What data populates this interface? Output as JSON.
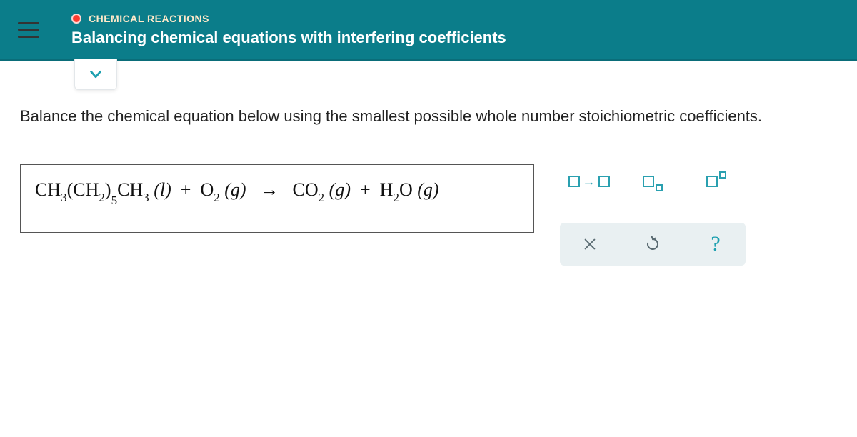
{
  "header": {
    "category": "CHEMICAL REACTIONS",
    "title": "Balancing chemical equations with interfering coefficients"
  },
  "instruction": "Balance the chemical equation below using the smallest possible whole number stoichiometric coefficients.",
  "equation": {
    "reactant1": {
      "ch3a": "CH",
      "ch3a_sub": "3",
      "open": "(",
      "ch2": "CH",
      "ch2_sub": "2",
      "close": ")",
      "outer_sub": "5",
      "ch3b": "CH",
      "ch3b_sub": "3",
      "state": "(l)"
    },
    "plus1": "+",
    "reactant2": {
      "o": "O",
      "o_sub": "2",
      "state": "(g)"
    },
    "arrow": "→",
    "product1": {
      "co": "CO",
      "co_sub": "2",
      "state": "(g)"
    },
    "plus2": "+",
    "product2": {
      "h": "H",
      "h_sub": "2",
      "o": "O",
      "state": "(g)"
    }
  },
  "keypad": {
    "arrow_tool": "□→□",
    "subscript_tool": "subscript",
    "superscript_tool": "superscript",
    "clear": "×",
    "reset": "↺",
    "help": "?"
  }
}
